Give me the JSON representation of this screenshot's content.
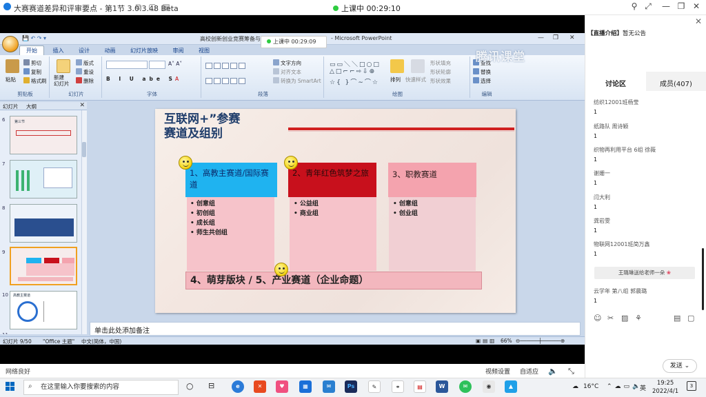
{
  "app": {
    "title": "大赛赛道差异和评审要点 - 第1节 3.0.3.48 Beta",
    "live_status": "上课中 00:29:10",
    "network": "网络良好",
    "bottom_right": {
      "video_settings": "视频设置",
      "self_select": "自适应"
    }
  },
  "ppt": {
    "window_title": "高校创新创业竞赛筹备与",
    "window_title_suffix": "- Microsoft PowerPoint",
    "inner_live": "上课中 00:29:09",
    "tabs": [
      "开始",
      "插入",
      "设计",
      "动画",
      "幻灯片放映",
      "审阅",
      "视图"
    ],
    "ribbon": {
      "paste": "粘贴",
      "cut": "剪切",
      "copy": "复制",
      "format_painter": "格式刷",
      "clipboard": "剪贴板",
      "new_slide": "新建\n幻灯片",
      "layout": "版式",
      "reset": "重设",
      "delete": "删除",
      "slides": "幻灯片",
      "font": "字体",
      "text_direction": "文字方向",
      "align_text": "对齐文本",
      "to_smartart": "转换为 SmartArt",
      "paragraph": "段落",
      "arrange": "排列",
      "quick_styles": "快速样式",
      "shape_fill": "形状填充",
      "shape_outline": "形状轮廓",
      "shape_effects": "形状效果",
      "drawing": "绘图",
      "find": "查找",
      "replace": "替换",
      "select": "选择",
      "editing": "编辑"
    },
    "watermark": "腾讯课堂",
    "panel_tabs": {
      "slides": "幻灯片",
      "outline": "大纲"
    },
    "thumbnails": [
      {
        "num": "6",
        "text": "第三节"
      },
      {
        "num": "7",
        "text": ""
      },
      {
        "num": "8",
        "text": ""
      },
      {
        "num": "9",
        "text": ""
      },
      {
        "num": "10",
        "text": "高教主赛道"
      },
      {
        "num": "11",
        "text": ""
      }
    ],
    "slide": {
      "title_line1": "互联网+”参赛",
      "title_line2": "赛道及组别",
      "columns": [
        {
          "header": "1、高教主赛道/国际赛道",
          "items": [
            "创意组",
            "初创组",
            "成长组",
            "师生共创组"
          ]
        },
        {
          "header": "2、青年红色筑梦之旅",
          "items": [
            "公益组",
            "商业组"
          ]
        },
        {
          "header": "3、职教赛道",
          "items": [
            "创意组",
            "创业组"
          ]
        }
      ],
      "bottom": "4、萌芽版块 / 5、产业赛道（企业命题）"
    },
    "notes_placeholder": "单击此处添加备注",
    "status": {
      "slide_count": "幻灯片 9/50",
      "theme": "\"Office 主题\"",
      "language": "中文(简体，中国)",
      "zoom": "66%"
    },
    "colors": {
      "col1_head": "#1fb3f0",
      "col2_head": "#c8101c",
      "col3_head": "#f4a3ae",
      "title": "#1f3d6b",
      "accent_rule": "#d02020"
    }
  },
  "right_panel": {
    "notice_label": "【直播介绍】",
    "notice_text": "暂无公告",
    "tabs": {
      "discussion": "讨论区",
      "members": "成员(407)"
    },
    "messages": [
      {
        "name": "纺织12001班杨莹",
        "text": "1"
      },
      {
        "name": "纸路队 周诗颖",
        "text": "1"
      },
      {
        "name": "织物再利用平台 6组 徐薇",
        "text": "1"
      },
      {
        "name": "谢姗一",
        "text": "1"
      },
      {
        "name": "闫大利",
        "text": "1"
      },
      {
        "name": "龚岩雯",
        "text": "1"
      },
      {
        "name": "物联网12001班简万鑫",
        "text": "1"
      }
    ],
    "gift": "王璐琳送给老师一朵",
    "last_message": {
      "name": "云学年 第八组 郭晨璐",
      "text": "1"
    },
    "send": "发送"
  },
  "taskbar": {
    "search_placeholder": "在这里输入你要搜索的内容",
    "weather": "16°C",
    "ime": "英",
    "time": "19:25",
    "date": "2022/4/1",
    "notification_count": "3"
  }
}
